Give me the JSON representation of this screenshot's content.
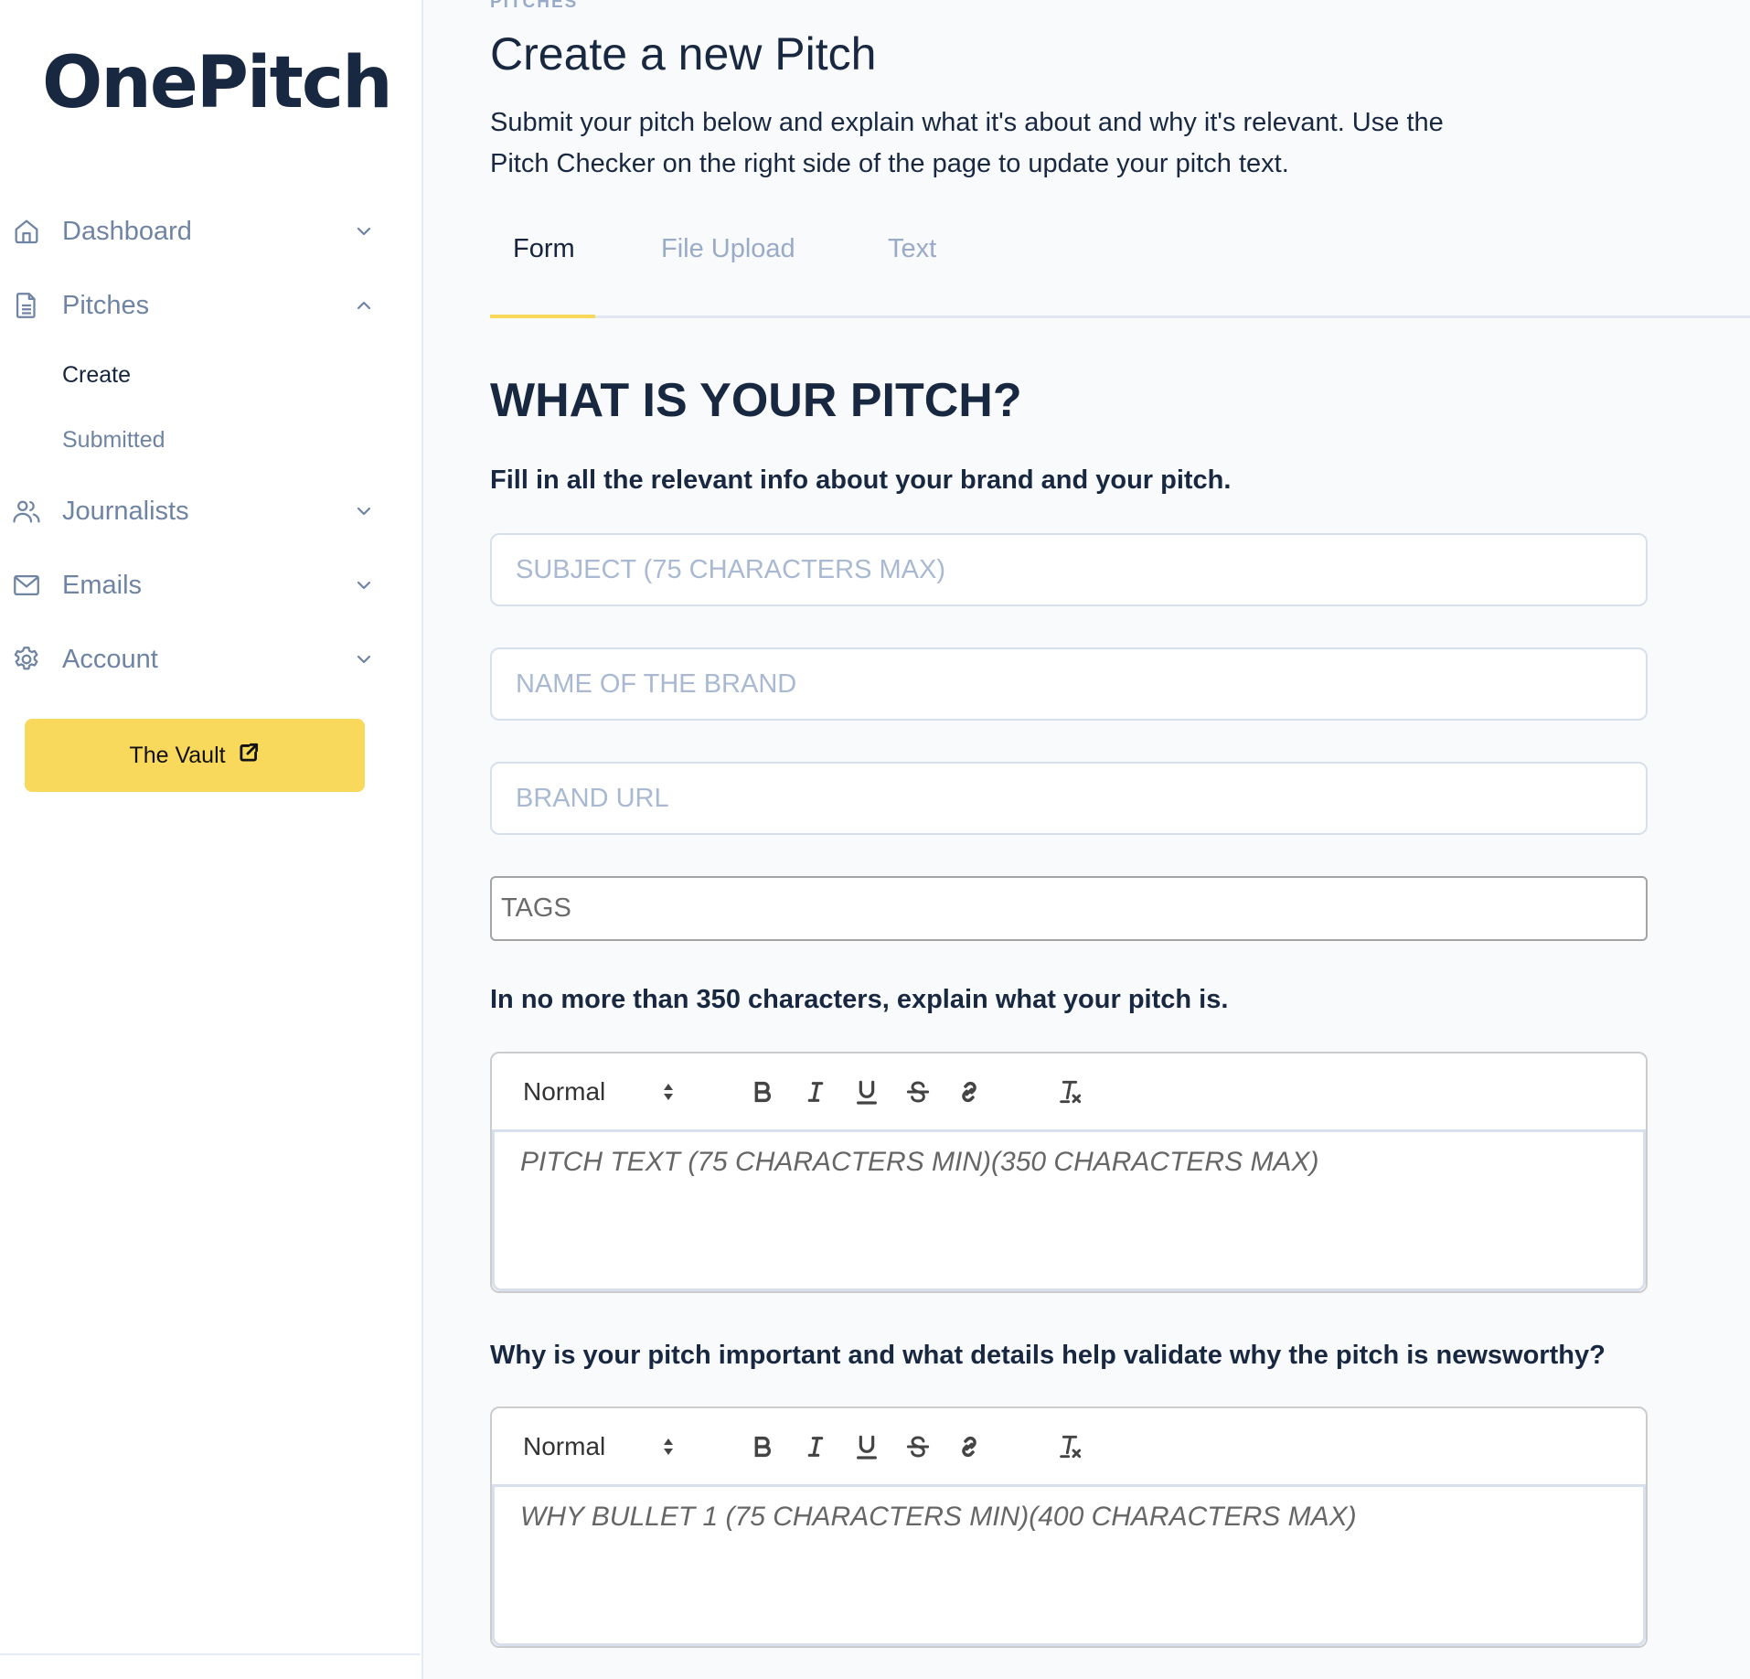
{
  "app": {
    "logo": "OnePitch"
  },
  "sidebar": {
    "items": [
      {
        "label": "Dashboard",
        "icon": "home-icon",
        "expanded": false
      },
      {
        "label": "Pitches",
        "icon": "document-icon",
        "expanded": true,
        "children": [
          {
            "label": "Create",
            "active": true
          },
          {
            "label": "Submitted",
            "active": false
          }
        ]
      },
      {
        "label": "Journalists",
        "icon": "users-icon",
        "expanded": false
      },
      {
        "label": "Emails",
        "icon": "mail-icon",
        "expanded": false
      },
      {
        "label": "Account",
        "icon": "gear-icon",
        "expanded": false
      }
    ],
    "vault_button": {
      "label": "The Vault",
      "icon": "external-link-icon"
    }
  },
  "header": {
    "eyebrow": "PITCHES",
    "title": "Create a new Pitch",
    "description": "Submit your pitch below and explain what it's about and why it's relevant. Use the Pitch Checker on the right side of the page to update your pitch text."
  },
  "tabs": [
    {
      "label": "Form",
      "active": true
    },
    {
      "label": "File Upload",
      "active": false
    },
    {
      "label": "Text",
      "active": false
    }
  ],
  "form": {
    "heading": "WHAT IS YOUR PITCH?",
    "subheading": "Fill in all the relevant info about your brand and your pitch.",
    "fields": {
      "subject": {
        "value": "",
        "placeholder": "SUBJECT (75 CHARACTERS MAX)"
      },
      "brand_name": {
        "value": "",
        "placeholder": "NAME OF THE BRAND"
      },
      "brand_url": {
        "value": "",
        "placeholder": "BRAND URL"
      },
      "tags": {
        "value": "",
        "placeholder": "TAGS"
      }
    },
    "pitch_label": "In no more than 350 characters, explain what your pitch is.",
    "pitch_editor": {
      "format_select": "Normal",
      "placeholder": "PITCH TEXT (75 CHARACTERS MIN)(350 CHARACTERS MAX)",
      "toolbar": [
        "bold",
        "italic",
        "underline",
        "strikethrough",
        "link",
        "clear-format"
      ]
    },
    "why_label": "Why is your pitch important and what details help validate why the pitch is newsworthy?",
    "why_editor": {
      "format_select": "Normal",
      "placeholder": "WHY BULLET 1 (75 CHARACTERS MIN)(400 CHARACTERS MAX)",
      "toolbar": [
        "bold",
        "italic",
        "underline",
        "strikethrough",
        "link",
        "clear-format"
      ]
    }
  },
  "colors": {
    "accent": "#f9d95b",
    "navy": "#192841",
    "muted": "#6f84a3",
    "placeholder": "#a9b9d1",
    "background": "#f8fafc"
  }
}
